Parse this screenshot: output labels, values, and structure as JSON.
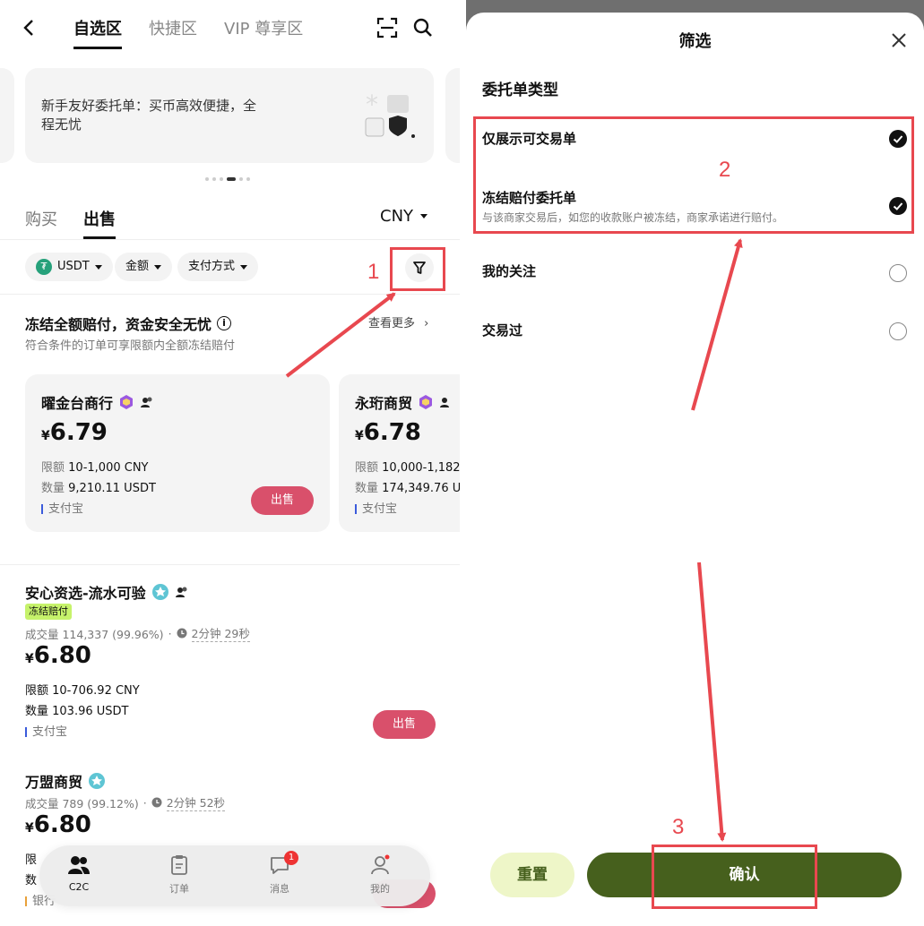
{
  "left": {
    "header": {
      "tabs": [
        "自选区",
        "快捷区",
        "VIP 尊享区"
      ]
    },
    "banner": {
      "text": "新手友好委托单：买币高效便捷，全程无忧"
    },
    "trade_tabs": {
      "buy": "购买",
      "sell": "出售",
      "currency": "CNY"
    },
    "filters": {
      "coin": "USDT",
      "amount": "金额",
      "payment": "支付方式"
    },
    "section": {
      "title": "冻结全额赔付，资金安全无忧",
      "subtitle": "符合条件的订单可享限额内全额冻结赔付",
      "more": "查看更多"
    },
    "featured": [
      {
        "name": "曜金台商行",
        "currency_symbol": "¥",
        "price": "6.79",
        "limit_label": "限额",
        "limit": "10-1,000 CNY",
        "qty_label": "数量",
        "qty": "9,210.11 USDT",
        "payment": "支付宝",
        "action": "出售"
      },
      {
        "name": "永珩商贸",
        "currency_symbol": "¥",
        "price": "6.78",
        "limit_label": "限额",
        "limit": "10,000-1,182",
        "qty_label": "数量",
        "qty": "174,349.76 U",
        "payment": "支付宝"
      }
    ],
    "listings": [
      {
        "name": "安心资选-流水可验",
        "badge": "冻结赔付",
        "volume": "成交量 114,337 (99.96%)",
        "time": "2分钟 29秒",
        "currency_symbol": "¥",
        "price": "6.80",
        "limit": "限额 10-706.92 CNY",
        "qty": "数量 103.96 USDT",
        "payment": "支付宝",
        "action": "出售"
      },
      {
        "name": "万盟商贸",
        "volume": "成交量 789 (99.12%)",
        "time": "2分钟 52秒",
        "currency_symbol": "¥",
        "price": "6.80",
        "limit_fragment": "限",
        "qty_fragment": "数",
        "payment_fragment": "银行"
      }
    ],
    "bottom_nav": [
      {
        "label": "C2C",
        "icon": "people-icon"
      },
      {
        "label": "订单",
        "icon": "clipboard-icon"
      },
      {
        "label": "消息",
        "icon": "chat-icon",
        "badge": "1"
      },
      {
        "label": "我的",
        "icon": "user-icon"
      }
    ]
  },
  "right": {
    "title": "筛选",
    "section_title": "委托单类型",
    "options": [
      {
        "label": "仅展示可交易单",
        "checked": true
      },
      {
        "label": "冻结赔付委托单",
        "desc": "与该商家交易后，如您的收款账户被冻结，商家承诺进行赔付。",
        "checked": true
      },
      {
        "label": "我的关注",
        "checked": false
      },
      {
        "label": "交易过",
        "checked": false
      }
    ],
    "reset": "重置",
    "confirm": "确认"
  },
  "annotations": {
    "steps": [
      "1",
      "2",
      "3"
    ],
    "color": "#e8484f"
  },
  "colors": {
    "sell": "#d9506b",
    "confirm": "#46601d",
    "reset": "#eef6c8",
    "badge": "#c6f26b"
  }
}
